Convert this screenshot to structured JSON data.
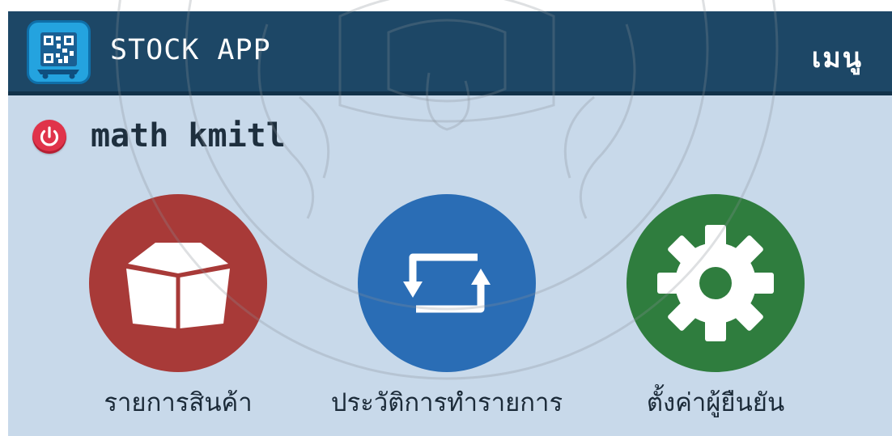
{
  "header": {
    "app_title": "STOCK APP",
    "menu_label": "เมนู",
    "logo_icon": "qr-cart-logo-icon"
  },
  "user": {
    "name": "math kmitl",
    "power_icon": "power-icon"
  },
  "tiles": [
    {
      "label": "รายการสินค้า",
      "icon": "box-icon",
      "color": "#a83a38"
    },
    {
      "label": "ประวัติการทำรายการ",
      "icon": "refresh-arrows-icon",
      "color": "#2a6db5"
    },
    {
      "label": "ตั้งค่าผู้ยืนยัน",
      "icon": "gear-icon",
      "color": "#2f7d3e"
    }
  ],
  "colors": {
    "header_bg": "#1d4766",
    "screen_bg": "#c8d9ea",
    "power_button": "#e0334a"
  }
}
